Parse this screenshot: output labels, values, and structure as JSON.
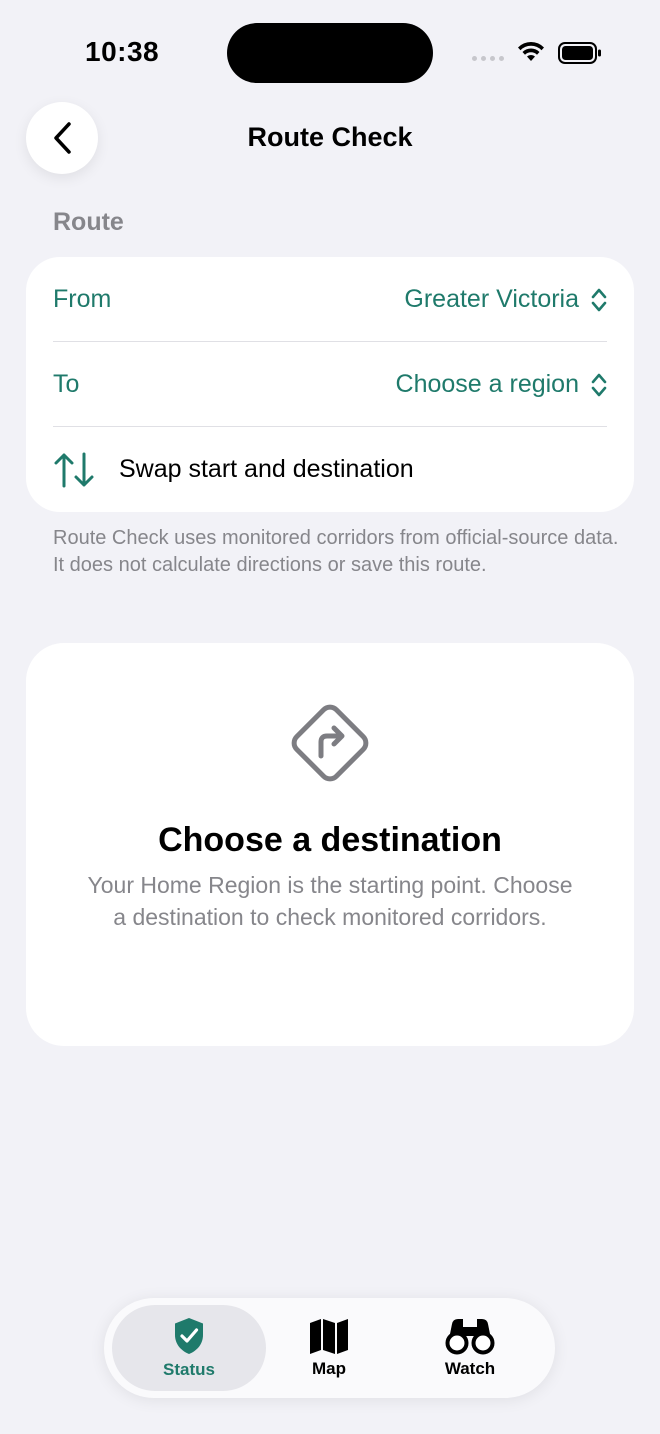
{
  "status_bar": {
    "time": "10:38"
  },
  "nav": {
    "title": "Route Check"
  },
  "route": {
    "section_header": "Route",
    "from_label": "From",
    "from_value": "Greater Victoria",
    "to_label": "To",
    "to_value": "Choose a region",
    "swap_label": "Swap start and destination"
  },
  "footnote": "Route Check uses monitored corridors from official-source data. It does not calculate directions or save this route.",
  "empty_state": {
    "title": "Choose a destination",
    "description": "Your Home Region is the starting point. Choose a destination to check monitored corridors."
  },
  "tabs": [
    {
      "label": "Status",
      "icon": "shield-check-icon",
      "active": true
    },
    {
      "label": "Map",
      "icon": "map-icon",
      "active": false
    },
    {
      "label": "Watch",
      "icon": "binoculars-icon",
      "active": false
    }
  ],
  "colors": {
    "accent": "#1f7a6b",
    "background": "#f2f2f7",
    "secondary_text": "#86868b"
  }
}
